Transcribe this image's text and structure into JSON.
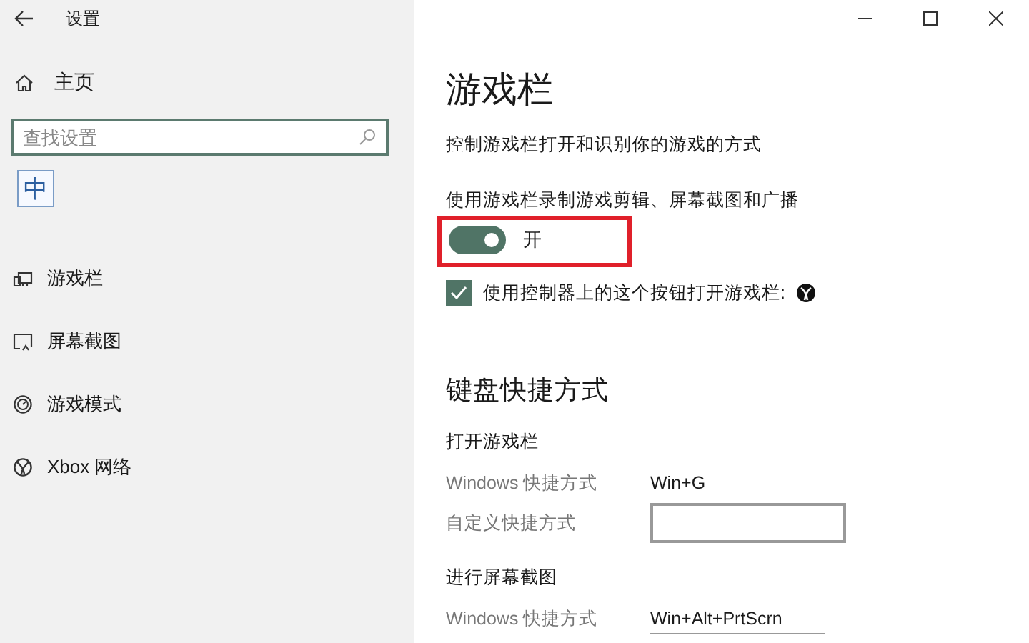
{
  "window": {
    "title": "设置"
  },
  "sidebar": {
    "home": "主页",
    "search": {
      "placeholder": "查找设置"
    },
    "ime": "中",
    "items": [
      {
        "kind": "gamebar",
        "label": "游戏栏"
      },
      {
        "kind": "capture",
        "label": "屏幕截图"
      },
      {
        "kind": "gamemode",
        "label": "游戏模式"
      },
      {
        "kind": "xbox",
        "label": "Xbox 网络"
      }
    ]
  },
  "content": {
    "title": "游戏栏",
    "description": "控制游戏栏打开和识别你的游戏的方式",
    "record_label": "使用游戏栏录制游戏剪辑、屏幕截图和广播",
    "toggle": {
      "on": true,
      "label": "开",
      "highlighted": true
    },
    "controller": {
      "checked": true,
      "label": "使用控制器上的这个按钮打开游戏栏:"
    },
    "shortcuts_title": "键盘快捷方式",
    "groups": [
      {
        "title": "打开游戏栏",
        "rows": [
          {
            "kind": "fixed",
            "label": "Windows 快捷方式",
            "value": "Win+G"
          },
          {
            "kind": "custom",
            "label": "自定义快捷方式"
          }
        ]
      },
      {
        "title": "进行屏幕截图",
        "rows": [
          {
            "kind": "fixed",
            "label": "Windows 快捷方式",
            "value": "Win+Alt+PrtScrn"
          }
        ]
      }
    ]
  }
}
